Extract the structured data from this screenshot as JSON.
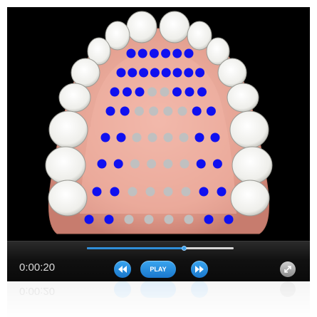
{
  "player": {
    "current_time": "0:00:20",
    "play_label": "PLAY",
    "progress": 0.66,
    "reflection_time": "0:00:20"
  },
  "colors": {
    "accent": "#2f8ed8",
    "dot_active": "#1010f0",
    "dot_inactive": "#c0c0c0",
    "gum": "#e6a79a"
  },
  "icons": {
    "rewind": "rewind-icon",
    "forward": "fast-forward-icon",
    "fullscreen": "fullscreen-icon"
  },
  "dot_grid": {
    "rows": [
      [
        1,
        1,
        1,
        1,
        1,
        1
      ],
      [
        1,
        1,
        1,
        1,
        1,
        1,
        1,
        1
      ],
      [
        1,
        1,
        1,
        0,
        0,
        1,
        1,
        1
      ],
      [
        1,
        1,
        0,
        0,
        0,
        0,
        1,
        1
      ],
      [
        1,
        1,
        0,
        0,
        0,
        0,
        1,
        1
      ],
      [
        1,
        1,
        0,
        0,
        0,
        0,
        1,
        1
      ],
      [
        1,
        1,
        0,
        0,
        0,
        0,
        1,
        1
      ],
      [
        1,
        1,
        0,
        0,
        0,
        0,
        1,
        1
      ]
    ]
  }
}
